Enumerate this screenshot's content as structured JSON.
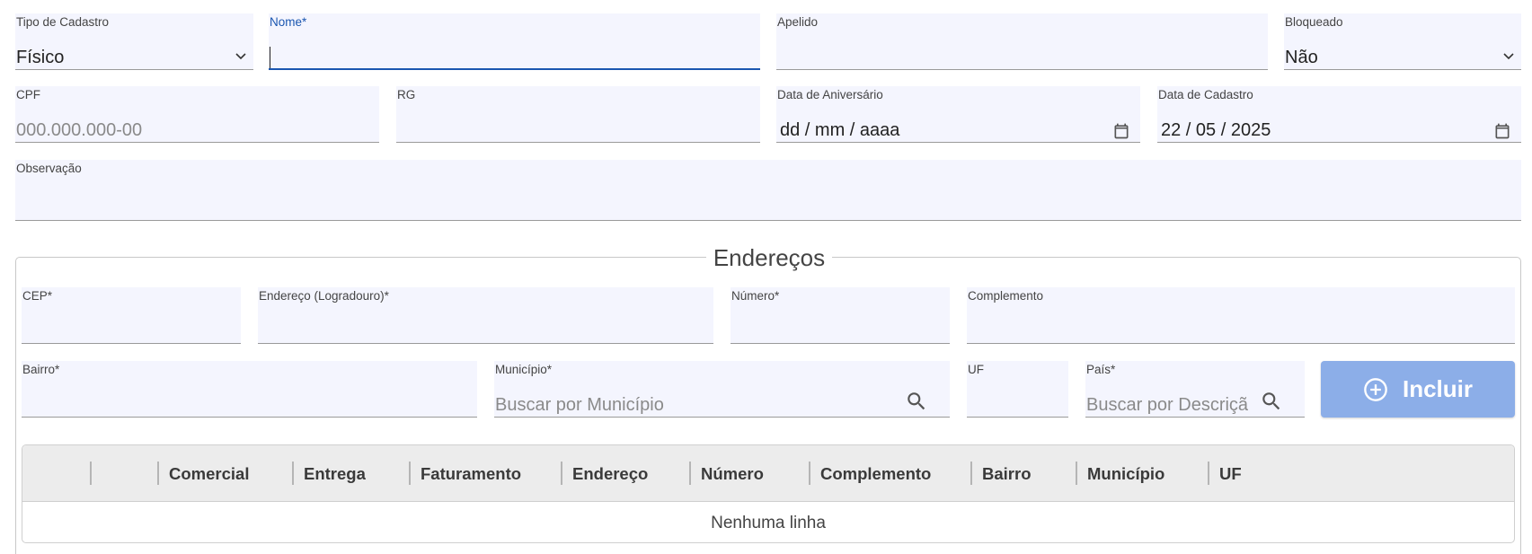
{
  "cadastro": {
    "tipo": {
      "label": "Tipo de Cadastro",
      "value": "Físico"
    },
    "nome": {
      "label": "Nome*",
      "value": ""
    },
    "apelido": {
      "label": "Apelido",
      "value": ""
    },
    "bloqueado": {
      "label": "Bloqueado",
      "value": "Não"
    },
    "cpf": {
      "label": "CPF",
      "placeholder": "000.000.000-00"
    },
    "rg": {
      "label": "RG",
      "value": ""
    },
    "aniversario": {
      "label": "Data de Aniversário",
      "placeholder": "dd / mm / aaaa"
    },
    "data_cadastro": {
      "label": "Data de Cadastro",
      "value": "22 / 05 / 2025"
    },
    "observacao": {
      "label": "Observação",
      "value": ""
    }
  },
  "enderecos": {
    "legend": "Endereços",
    "cep": {
      "label": "CEP*",
      "value": ""
    },
    "logradouro": {
      "label": "Endereço (Logradouro)*",
      "value": ""
    },
    "numero": {
      "label": "Número*",
      "value": ""
    },
    "complemento": {
      "label": "Complemento",
      "value": ""
    },
    "bairro": {
      "label": "Bairro*",
      "value": ""
    },
    "municipio": {
      "label": "Município*",
      "placeholder": "Buscar por Município"
    },
    "uf": {
      "label": "UF",
      "value": ""
    },
    "pais": {
      "label": "País*",
      "placeholder": "Buscar por Descriçã"
    },
    "incluir_label": "Incluir"
  },
  "grid": {
    "columns": [
      "",
      "",
      "Comercial",
      "Entrega",
      "Faturamento",
      "Endereço",
      "Número",
      "Complemento",
      "Bairro",
      "Município",
      "UF"
    ],
    "empty_text": "Nenhuma linha"
  },
  "colors": {
    "field_bg": "#f4f5fe",
    "focus": "#1a56b0",
    "button": "#8caee8"
  },
  "icons": {
    "select": "chevron-down-icon",
    "date": "calendar-icon",
    "search": "search-icon",
    "add": "add-circle-icon"
  }
}
